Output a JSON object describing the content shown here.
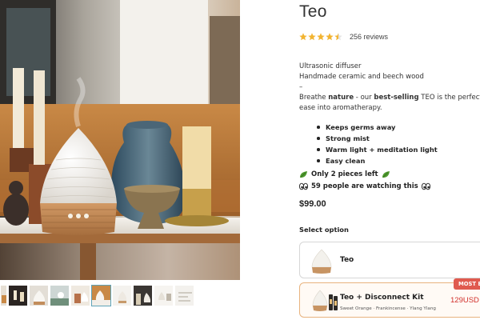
{
  "product": {
    "title": "Teo",
    "rating": 4.5,
    "reviews_label": "256 reviews",
    "desc_line1": "Ultrasonic diffuser",
    "desc_line2": "Handmade ceramic and beech wood",
    "desc_dash": "–",
    "desc_p1": "Breathe ",
    "desc_b1": "nature",
    "desc_p2": " - our ",
    "desc_b2": "best-selling",
    "desc_p3": " TEO is the perfect ch",
    "desc_p4": "ease into aromatherapy.",
    "features": [
      "Keeps germs away",
      "Strong mist",
      "Warm light + meditation light",
      "Easy clean"
    ],
    "stock_notice": "Only 2 pieces left",
    "watch_notice": "59 people are watching this",
    "price": "$99.00",
    "select_label": "Select option",
    "options": [
      {
        "name": "Teo"
      },
      {
        "name": "Teo + Disconnect Kit",
        "sub": "Sweet Orange · Frankincense · Ylang Ylang",
        "price": "129USD",
        "badge": "MOST B"
      }
    ]
  },
  "colors": {
    "star": "#f2b431",
    "badge": "#e05a4f",
    "option_price": "#d2322d",
    "selected_border": "#e8b37e"
  },
  "icons": {
    "stock": "leaf-icon",
    "watch": "eyes-icon"
  }
}
